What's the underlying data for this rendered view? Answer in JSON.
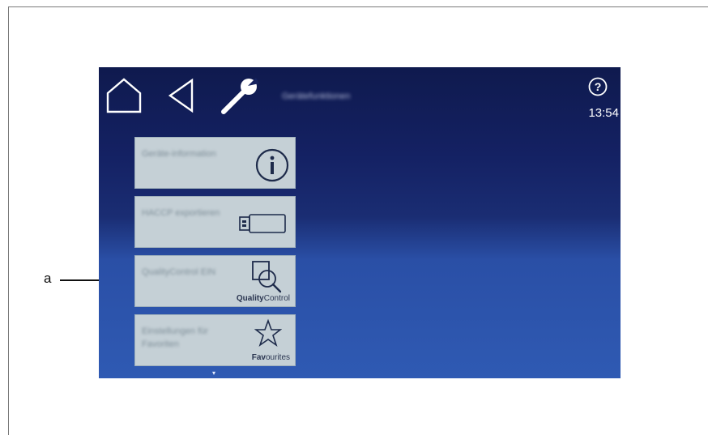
{
  "callout": {
    "label": "a"
  },
  "header": {
    "title": "Gerätefunktionen",
    "time": "13:54",
    "icons": [
      "home-icon",
      "back-icon",
      "wrench-icon",
      "help-icon"
    ]
  },
  "tiles": [
    {
      "label": "Geräte-information",
      "icon": "info-icon",
      "caption_bold": "",
      "caption_rest": ""
    },
    {
      "label": "HACCP exportieren",
      "icon": "usb-stick-icon",
      "caption_bold": "",
      "caption_rest": ""
    },
    {
      "label": "QualityControl EIN",
      "icon": "quality-control-icon",
      "caption_bold": "Quality",
      "caption_rest": "Control"
    },
    {
      "label": "Einstellungen für Favoriten",
      "icon": "star-icon",
      "caption_bold": "Fav",
      "caption_rest": "ourites"
    }
  ],
  "scroll_indicator": "▾",
  "colors": {
    "screen_top": "#0f1a4e",
    "screen_bottom": "#2f5ab3",
    "tile_bg": "#c5d0d6"
  }
}
